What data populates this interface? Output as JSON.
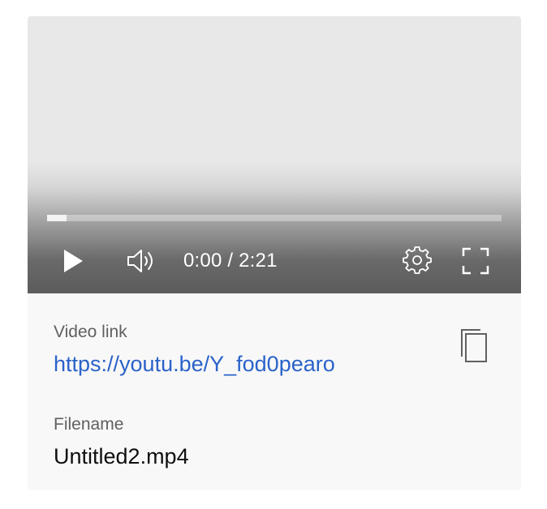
{
  "player": {
    "time_display": "0:00 / 2:21",
    "progress_loaded_fraction": 0.043,
    "icons": {
      "play": "play-icon",
      "volume": "volume-icon",
      "settings": "gear-icon",
      "fullscreen": "fullscreen-icon"
    }
  },
  "info": {
    "video_link_label": "Video link",
    "video_link_url": "https://youtu.be/Y_fod0pearo",
    "copy_icon": "copy-icon",
    "filename_label": "Filename",
    "filename": "Untitled2.mp4"
  },
  "colors": {
    "link": "#2a62c9",
    "player_bg": "#e8e8e8",
    "info_bg": "#f8f8f8"
  }
}
